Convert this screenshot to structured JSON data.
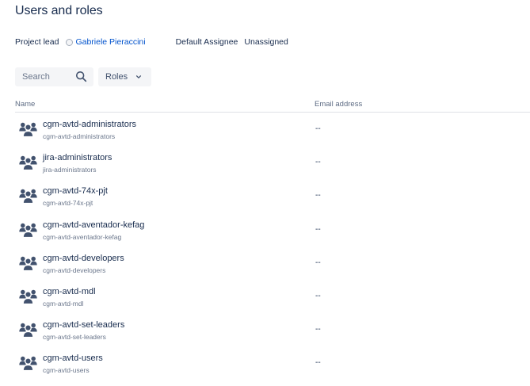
{
  "page": {
    "title": "Users and roles"
  },
  "meta": {
    "project_lead_label": "Project lead",
    "project_lead_name": "Gabriele Pieraccini",
    "default_assignee_label": "Default Assignee",
    "default_assignee_value": "Unassigned"
  },
  "toolbar": {
    "search_placeholder": "Search",
    "roles_label": "Roles"
  },
  "table": {
    "columns": [
      "Name",
      "Email address"
    ],
    "rows": [
      {
        "name": "cgm-avtd-administrators",
        "subtitle": "cgm-avtd-administrators",
        "email": "--"
      },
      {
        "name": "jira-administrators",
        "subtitle": "jira-administrators",
        "email": "--"
      },
      {
        "name": "cgm-avtd-74x-pjt",
        "subtitle": "cgm-avtd-74x-pjt",
        "email": "--"
      },
      {
        "name": "cgm-avtd-aventador-kefag",
        "subtitle": "cgm-avtd-aventador-kefag",
        "email": "--"
      },
      {
        "name": "cgm-avtd-developers",
        "subtitle": "cgm-avtd-developers",
        "email": "--"
      },
      {
        "name": "cgm-avtd-mdl",
        "subtitle": "cgm-avtd-mdl",
        "email": "--"
      },
      {
        "name": "cgm-avtd-set-leaders",
        "subtitle": "cgm-avtd-set-leaders",
        "email": "--"
      },
      {
        "name": "cgm-avtd-users",
        "subtitle": "cgm-avtd-users",
        "email": "--"
      }
    ]
  },
  "icons": {
    "group": "group-icon",
    "search": "search-icon",
    "chevron": "chevron-down-icon"
  },
  "colors": {
    "text": "#172b4d",
    "link": "#0052cc",
    "muted": "#6b778c",
    "field_bg": "#f4f5f7",
    "divider": "#dfe1e6",
    "group_icon": "#42526e"
  }
}
